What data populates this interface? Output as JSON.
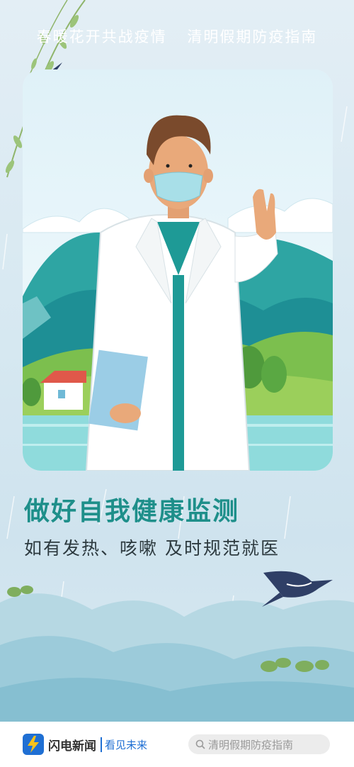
{
  "header": {
    "left": "春暖花开共战疫情",
    "right": "清明假期防疫指南"
  },
  "headline": "做好自我健康监测",
  "subline": "如有发热、咳嗽  及时规范就医",
  "footer": {
    "brand": "闪电新闻",
    "slogan": "看见未来",
    "search_placeholder": "清明假期防疫指南"
  },
  "colors": {
    "accent": "#1e8f8a",
    "card_bg": "#eaf6fa"
  },
  "icons": [
    "willow-branch-icon",
    "swallow-icon",
    "doctor-illustration",
    "lightning-logo-icon",
    "search-icon"
  ]
}
